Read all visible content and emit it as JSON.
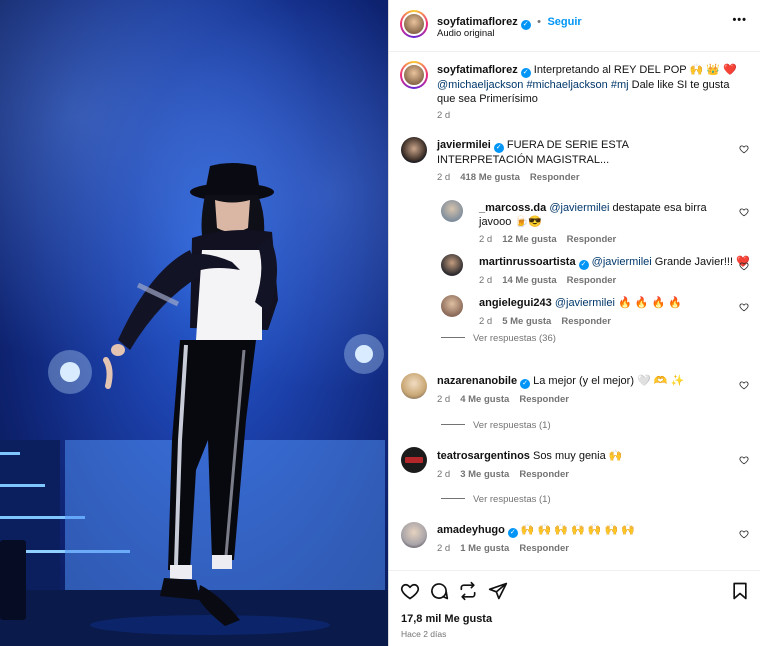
{
  "header": {
    "username": "soyfatimaflorez",
    "follow_label": "Seguir",
    "audio": "Audio original",
    "more_label": "•••"
  },
  "caption": {
    "username": "soyfatimaflorez",
    "text_lead": " Interpretando al REY DEL POP 🙌 👑 ❤️",
    "mention": "@michaeljackson",
    "hashtag1": "#michaeljackson",
    "hashtag2": "#mj",
    "text_tail": " Dale like SI te gusta que sea Primerísimo",
    "time": "2 d"
  },
  "comments": [
    {
      "username": "javiermilei",
      "verified": true,
      "text": " FUERA DE SERIE ESTA INTERPRETACIÓN MAGISTRAL...",
      "time": "2 d",
      "likes": "418 Me gusta",
      "reply": "Responder"
    },
    {
      "username": "_marcoss.da",
      "mention": "@javiermilei",
      "text": " destapate esa birra javooo 🍺😎",
      "time": "2 d",
      "likes": "12 Me gusta",
      "reply": "Responder"
    },
    {
      "username": "martinrussoartista",
      "verified": true,
      "mention": "@javiermilei",
      "text": " Grande Javier!!! ❤️",
      "time": "2 d",
      "likes": "14 Me gusta",
      "reply": "Responder"
    },
    {
      "username": "angielegui243",
      "mention": "@javiermilei",
      "text": " 🔥 🔥 🔥 🔥",
      "time": "2 d",
      "likes": "5 Me gusta",
      "reply": "Responder"
    },
    {
      "view_replies": "Ver respuestas (36)"
    },
    {
      "username": "nazarenanobile",
      "verified": true,
      "text": " La mejor (y el mejor) 🤍 🫶 ✨",
      "time": "2 d",
      "likes": "4 Me gusta",
      "reply": "Responder",
      "view_replies": "Ver respuestas (1)"
    },
    {
      "username": "teatrosargentinos",
      "text": " Sos muy genia 🙌",
      "time": "2 d",
      "likes": "3 Me gusta",
      "reply": "Responder",
      "view_replies": "Ver respuestas (1)"
    },
    {
      "username": "amadeyhugo",
      "verified": true,
      "text": " 🙌 🙌 🙌 🙌 🙌 🙌 🙌",
      "time": "2 d",
      "likes": "1 Me gusta",
      "reply": "Responder"
    }
  ],
  "footer": {
    "likes": "17,8 mil Me gusta",
    "ago": "Hace 2 días"
  },
  "colors": {
    "link": "#00376b",
    "verified": "#0095f6",
    "stage_blue": "#1b3fa8"
  },
  "icons": [
    "heart-icon",
    "comment-icon",
    "repost-icon",
    "share-icon",
    "bookmark-icon",
    "more-icon",
    "verified-icon"
  ]
}
